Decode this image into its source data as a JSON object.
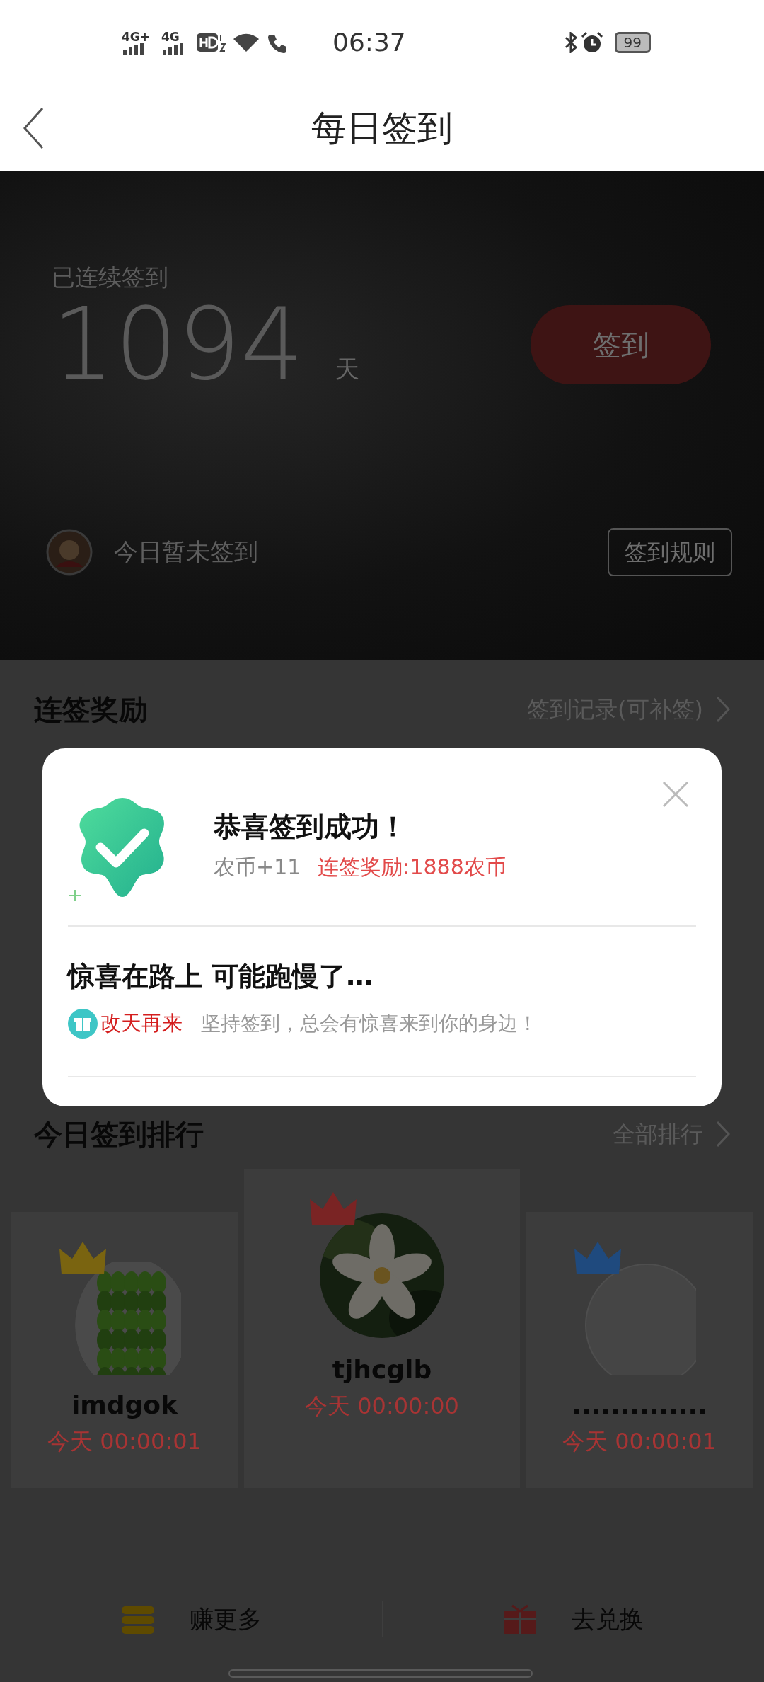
{
  "status_bar": {
    "networks": [
      "4G+",
      "4G"
    ],
    "time": "06:37",
    "battery": "99"
  },
  "header": {
    "title": "每日签到"
  },
  "hero": {
    "streak_label": "已连续签到",
    "streak_days": "1094",
    "unit": "天",
    "sign_button": "签到",
    "status": "今日暂未签到",
    "rules_button": "签到规则"
  },
  "streak_rewards": {
    "title": "连签奖励",
    "link": "签到记录(可补签)"
  },
  "ranking": {
    "title": "今日签到排行",
    "link": "全部排行",
    "entries": [
      {
        "name": "imdgok",
        "time": "今天 00:00:01",
        "color": "#7a6410",
        "raised": false
      },
      {
        "name": "tjhcglb",
        "time": "今天 00:00:00",
        "color": "#7a2424",
        "raised": true
      },
      {
        "name": "..............",
        "time": "今天 00:00:01",
        "color": "#1f4a7e",
        "raised": false
      }
    ]
  },
  "bottom_bar": [
    {
      "label": "赚更多",
      "kind": "coins"
    },
    {
      "label": "去兑换",
      "kind": "gift"
    }
  ],
  "dialog": {
    "title": "恭喜签到成功！",
    "coins": "农币+11",
    "bonus": "连签奖励:1888农币",
    "subtitle": "惊喜在路上 可能跑慢了…",
    "tag": "改天再来",
    "message": "坚持签到，总会有惊喜来到你的身边！"
  }
}
